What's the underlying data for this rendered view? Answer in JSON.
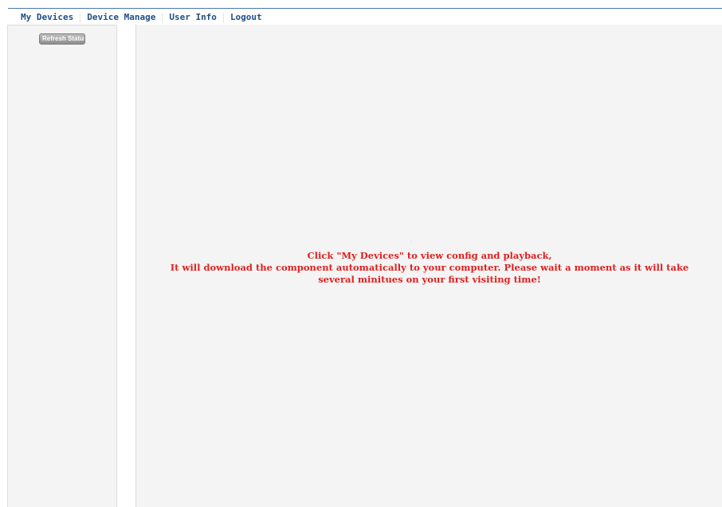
{
  "nav": {
    "items": [
      {
        "label": "My Devices"
      },
      {
        "label": "Device Manage"
      },
      {
        "label": "User Info"
      },
      {
        "label": "Logout"
      }
    ]
  },
  "sidebar": {
    "refresh_label": "Refresh Status"
  },
  "main": {
    "message_lines": [
      "Click \"My Devices\" to view config and playback,",
      "It will download the component automatically to your computer. Please wait a moment as it will take",
      "several minitues on your first visiting time!"
    ]
  },
  "colors": {
    "nav_text": "#1f4f86",
    "message_text": "#e0201e",
    "panel_bg": "#f4f4f4"
  }
}
